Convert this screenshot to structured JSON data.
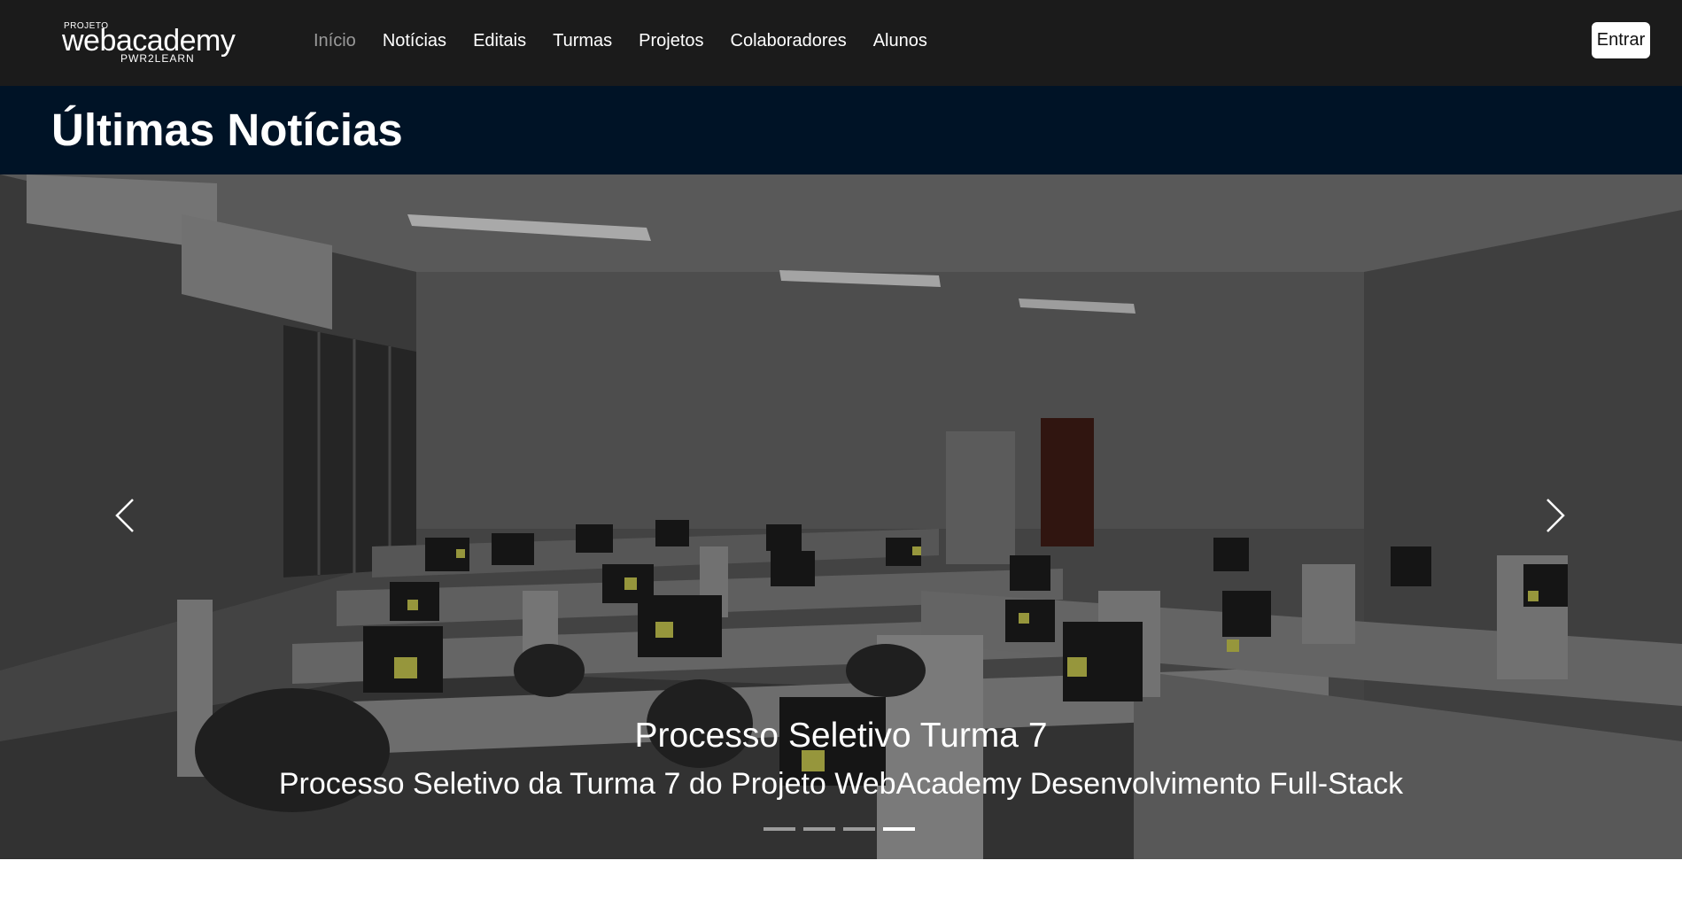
{
  "header": {
    "logo": {
      "top_text": "PROJETO",
      "main_text": "webacademy",
      "sub_text": "PWR2LEARN"
    },
    "nav_items": [
      {
        "label": "Início",
        "active": true
      },
      {
        "label": "Notícias",
        "active": false
      },
      {
        "label": "Editais",
        "active": false
      },
      {
        "label": "Turmas",
        "active": false
      },
      {
        "label": "Projetos",
        "active": false
      },
      {
        "label": "Colaboradores",
        "active": false
      },
      {
        "label": "Alunos",
        "active": false
      }
    ],
    "login_label": "Entrar"
  },
  "section": {
    "title": "Últimas Notícias"
  },
  "carousel": {
    "slide_count": 4,
    "active_index": 3,
    "caption_title": "Processo Seletivo Turma 7",
    "caption_text": "Processo Seletivo da Turma 7 do Projeto WebAcademy Desenvolvimento Full-Stack",
    "prev_icon": "chevron-left-icon",
    "next_icon": "chevron-right-icon"
  },
  "colors": {
    "navbar_bg": "#1b1b1b",
    "title_band_bg": "#001326",
    "nav_active": "#9a9a9a",
    "text_light": "#ffffff"
  }
}
